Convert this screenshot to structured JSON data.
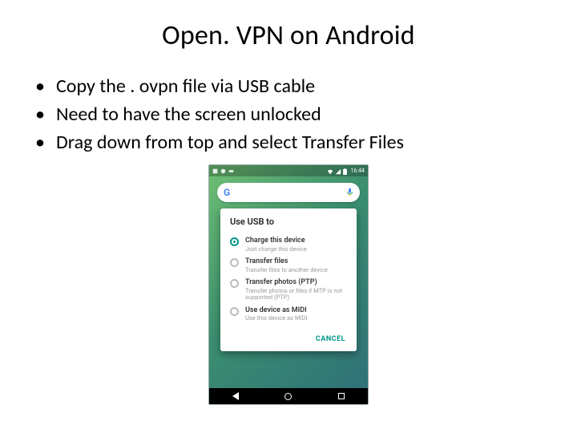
{
  "title": "Open. VPN on Android",
  "bullets": [
    "Copy the . ovpn file via USB cable",
    "Need to have the screen unlocked",
    "Drag down from top and select Transfer Files"
  ],
  "phone": {
    "status_time": "16:44",
    "search_logo": "Google",
    "dialog": {
      "title": "Use USB to",
      "options": [
        {
          "label": "Charge this device",
          "sub": "Just charge this device",
          "selected": true
        },
        {
          "label": "Transfer files",
          "sub": "Transfer files to another device",
          "selected": false
        },
        {
          "label": "Transfer photos (PTP)",
          "sub": "Transfer photos or files if MTP is not supported (PTP)",
          "selected": false
        },
        {
          "label": "Use device as MIDI",
          "sub": "Use this device as MIDI",
          "selected": false
        }
      ],
      "cancel": "CANCEL"
    }
  }
}
